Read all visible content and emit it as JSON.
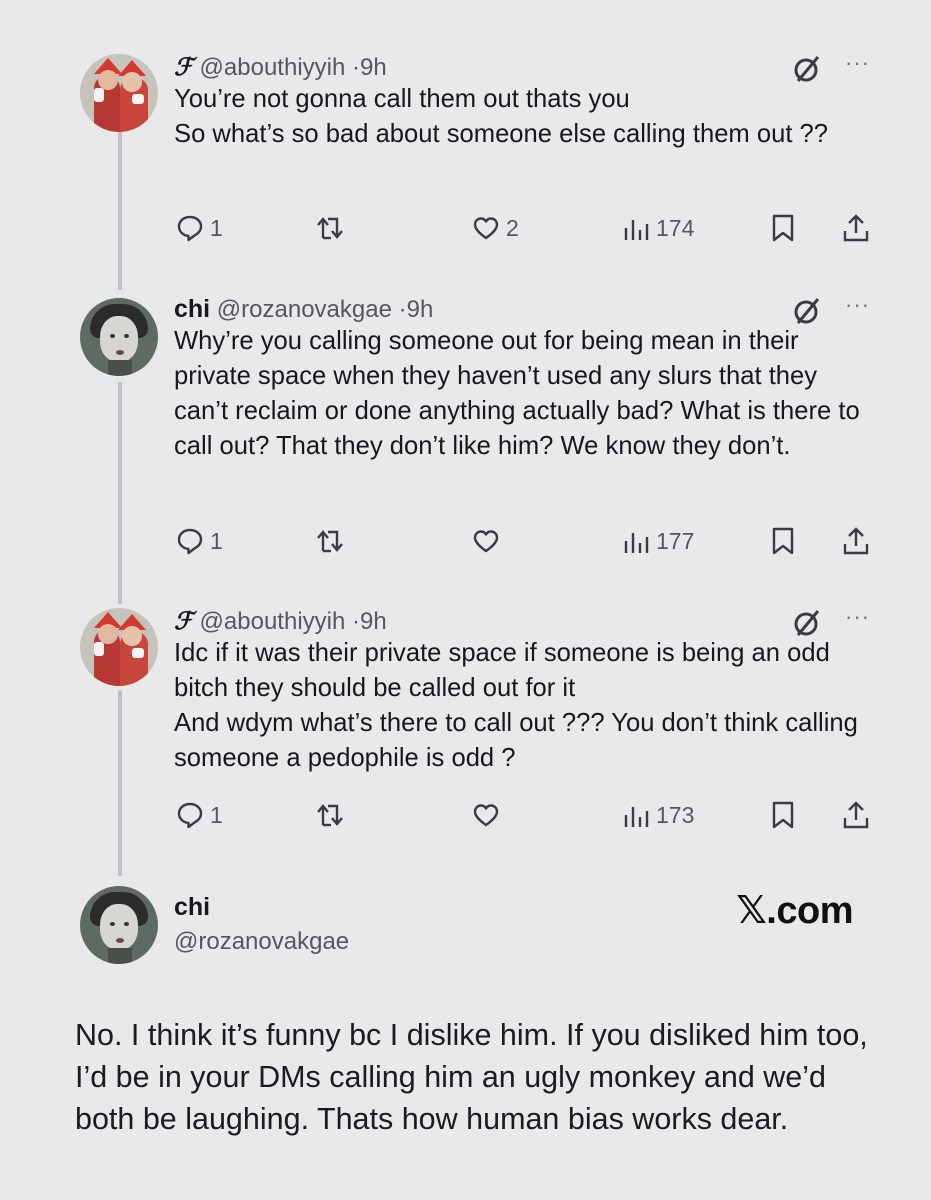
{
  "tweets": [
    {
      "author_glyph": "ℱ",
      "handle": "@abouthiyyih",
      "time": "9h",
      "text": "You’re not gonna call them out thats you\nSo what’s so bad about someone else calling them out ??",
      "replies": "1",
      "likes": "2",
      "views": "174"
    },
    {
      "author": "chi",
      "handle": "@rozanovakgae",
      "time": "9h",
      "text": "Why’re you calling someone out for being mean in their private space when they haven’t used any slurs that they can’t reclaim or done anything actually bad? What is there to call out? That they don’t like him? We know they don’t.",
      "replies": "1",
      "likes": "",
      "views": "177"
    },
    {
      "author_glyph": "ℱ",
      "handle": "@abouthiyyih",
      "time": "9h",
      "text": "Idc if it was their private space if someone is being an odd bitch they should be called out for it\nAnd wdym what’s there to call out ??? You don’t think calling someone a pedophile is odd ?",
      "replies": "1",
      "likes": "",
      "views": "173"
    }
  ],
  "highlight": {
    "author": "chi",
    "handle": "@rozanovakgae",
    "brand": "𝕏.com",
    "text": "No. I think it’s funny bc I dislike him. If you disliked him too, I’d be in your DMs calling him an ugly monkey and we’d both be laughing. Thats how human bias works dear."
  },
  "icons": {
    "reply": "reply-icon",
    "repost": "repost-icon",
    "like": "like-icon",
    "views": "views-icon",
    "bookmark": "bookmark-icon",
    "share": "share-icon",
    "grok": "grok-icon",
    "more": "more-icon"
  },
  "separator": "·",
  "more_label": "···"
}
